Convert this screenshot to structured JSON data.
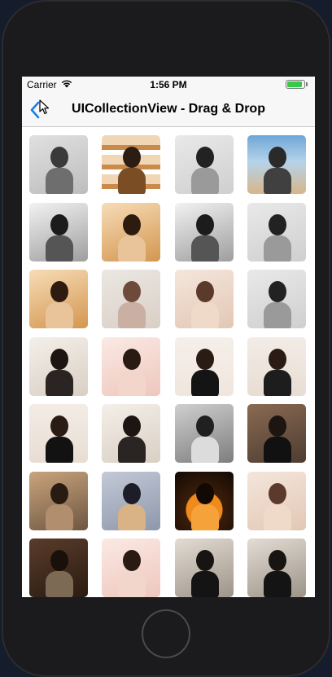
{
  "status_bar": {
    "carrier": "Carrier",
    "time": "1:56 PM",
    "battery_level": 1.0
  },
  "nav": {
    "title": "UICollectionView - Drag & Drop",
    "back_icon": "chevron-left-icon",
    "accent": "#1b7ee6"
  },
  "grid": {
    "columns": 4,
    "photos": [
      {
        "label": "photo-1",
        "style": "gray-drag"
      },
      {
        "label": "photo-2",
        "style": "warm-strip"
      },
      {
        "label": "photo-3",
        "style": "gray-light"
      },
      {
        "label": "photo-4",
        "style": "sky"
      },
      {
        "label": "photo-5",
        "style": "bw"
      },
      {
        "label": "photo-6",
        "style": "warm"
      },
      {
        "label": "photo-7",
        "style": "bw"
      },
      {
        "label": "photo-8",
        "style": "gray-light"
      },
      {
        "label": "photo-9",
        "style": "warm"
      },
      {
        "label": "photo-10",
        "style": "pale"
      },
      {
        "label": "photo-11",
        "style": "pale-warm"
      },
      {
        "label": "photo-12",
        "style": "gray-light"
      },
      {
        "label": "photo-13",
        "style": "portrait-dark"
      },
      {
        "label": "photo-14",
        "style": "portrait-light"
      },
      {
        "label": "photo-15",
        "style": "dress"
      },
      {
        "label": "photo-16",
        "style": "tissot"
      },
      {
        "label": "photo-17",
        "style": "tissot-dress"
      },
      {
        "label": "photo-18",
        "style": "portrait-dark"
      },
      {
        "label": "photo-19",
        "style": "bw-lying"
      },
      {
        "label": "photo-20",
        "style": "street"
      },
      {
        "label": "photo-21",
        "style": "outdoor"
      },
      {
        "label": "photo-22",
        "style": "teddy"
      },
      {
        "label": "photo-23",
        "style": "pumpkin"
      },
      {
        "label": "photo-24",
        "style": "pale-warm"
      },
      {
        "label": "photo-25",
        "style": "room"
      },
      {
        "label": "photo-26",
        "style": "portrait-light"
      },
      {
        "label": "photo-27",
        "style": "dark-coat"
      },
      {
        "label": "photo-28",
        "style": "dark-coat"
      }
    ]
  }
}
